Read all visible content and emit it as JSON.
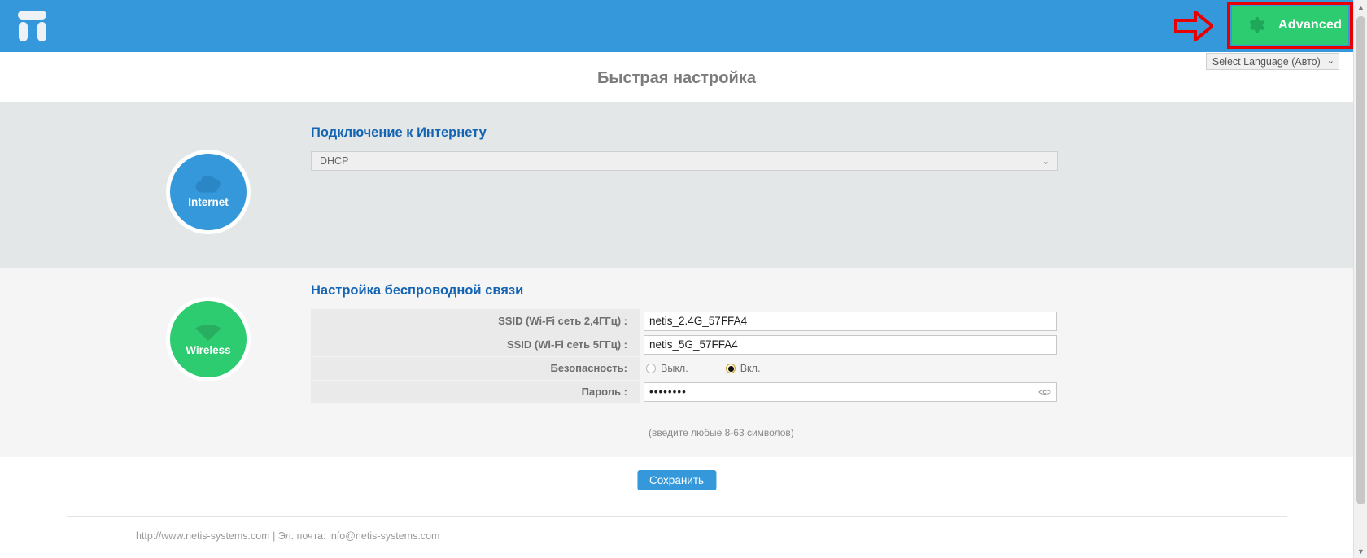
{
  "header": {
    "logo_name": "netis-logo",
    "advanced_button": {
      "label": "Advanced",
      "icon": "gear-icon",
      "color": "#2ecc71"
    },
    "annotation": {
      "arrow_icon": "red-arrow-icon",
      "highlight_color": "#e80000"
    },
    "brand_color": "#3498db"
  },
  "language": {
    "selected": "Select Language (Авто)",
    "chevron": "⌄"
  },
  "page": {
    "title": "Быстрая настройка"
  },
  "internet": {
    "badge_label": "Internet",
    "badge_icon": "cloud-icon",
    "badge_color": "#3498db",
    "heading": "Подключение к Интернету",
    "connection_type": "DHCP",
    "chevron": "⌄"
  },
  "wireless": {
    "badge_label": "Wireless",
    "badge_icon": "wifi-icon",
    "badge_color": "#2ecc71",
    "heading": "Настройка беспроводной связи",
    "rows": [
      {
        "label": "SSID (Wi-Fi сеть 2,4ГГц) :",
        "value": "netis_2.4G_57FFA4"
      },
      {
        "label": "SSID (Wi-Fi сеть 5ГГц) :",
        "value": "netis_5G_57FFA4"
      }
    ],
    "security": {
      "label": "Безопасность:",
      "options": [
        {
          "label": "Выкл.",
          "selected": false
        },
        {
          "label": "Вкл.",
          "selected": true
        }
      ]
    },
    "password": {
      "label": "Пароль :",
      "value": "••••••••",
      "hint": "(введите любые 8-63 символов)",
      "toggle_icon": "eye-icon"
    }
  },
  "actions": {
    "save_label": "Сохранить"
  },
  "footer": {
    "text": "http://www.netis-systems.com | Эл. почта: info@netis-systems.com"
  },
  "scrollbar": {
    "up_arrow": "▲",
    "down_arrow": "▼"
  }
}
